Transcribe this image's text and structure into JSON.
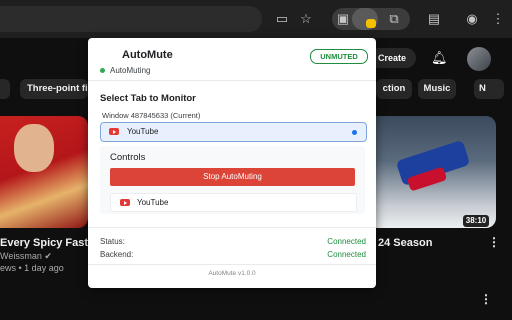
{
  "colors": {
    "accent_green": "#1e8e3e",
    "stop_red": "#db4437",
    "selection_blue": "#1a73e8",
    "youtube_red": "#e53935"
  },
  "toolbar": {
    "icons": [
      "cast-icon",
      "star-icon",
      "extension-icon",
      "automute-extension-icon",
      "window-icon",
      "tab-search-icon",
      "profile-icon",
      "menu-icon"
    ]
  },
  "youtube": {
    "create_label": "Create",
    "chips": [
      "Three-point fi",
      "ction",
      "Music",
      "N"
    ],
    "left_video": {
      "title": "Every Spicy Fast F",
      "channel": "Weissman",
      "meta_prefix": "ews",
      "meta_age": "1 day ago"
    },
    "right_video": {
      "title": "24 Season",
      "duration": "38:10"
    }
  },
  "popup": {
    "title": "AutoMute",
    "badge": "UNMUTED",
    "subtitle": "AutoMuting",
    "select_tab_title": "Select Tab to Monitor",
    "window_label": "Window 487845633 (Current)",
    "tabs": [
      {
        "label": "YouTube",
        "selected": true
      }
    ],
    "controls_title": "Controls",
    "stop_button": "Stop AutoMuting",
    "muting_tab": "YouTube",
    "status_label": "Status:",
    "status_value": "Connected",
    "backend_label": "Backend:",
    "backend_value": "Connected",
    "footer": "AutoMute v1.0.0"
  }
}
